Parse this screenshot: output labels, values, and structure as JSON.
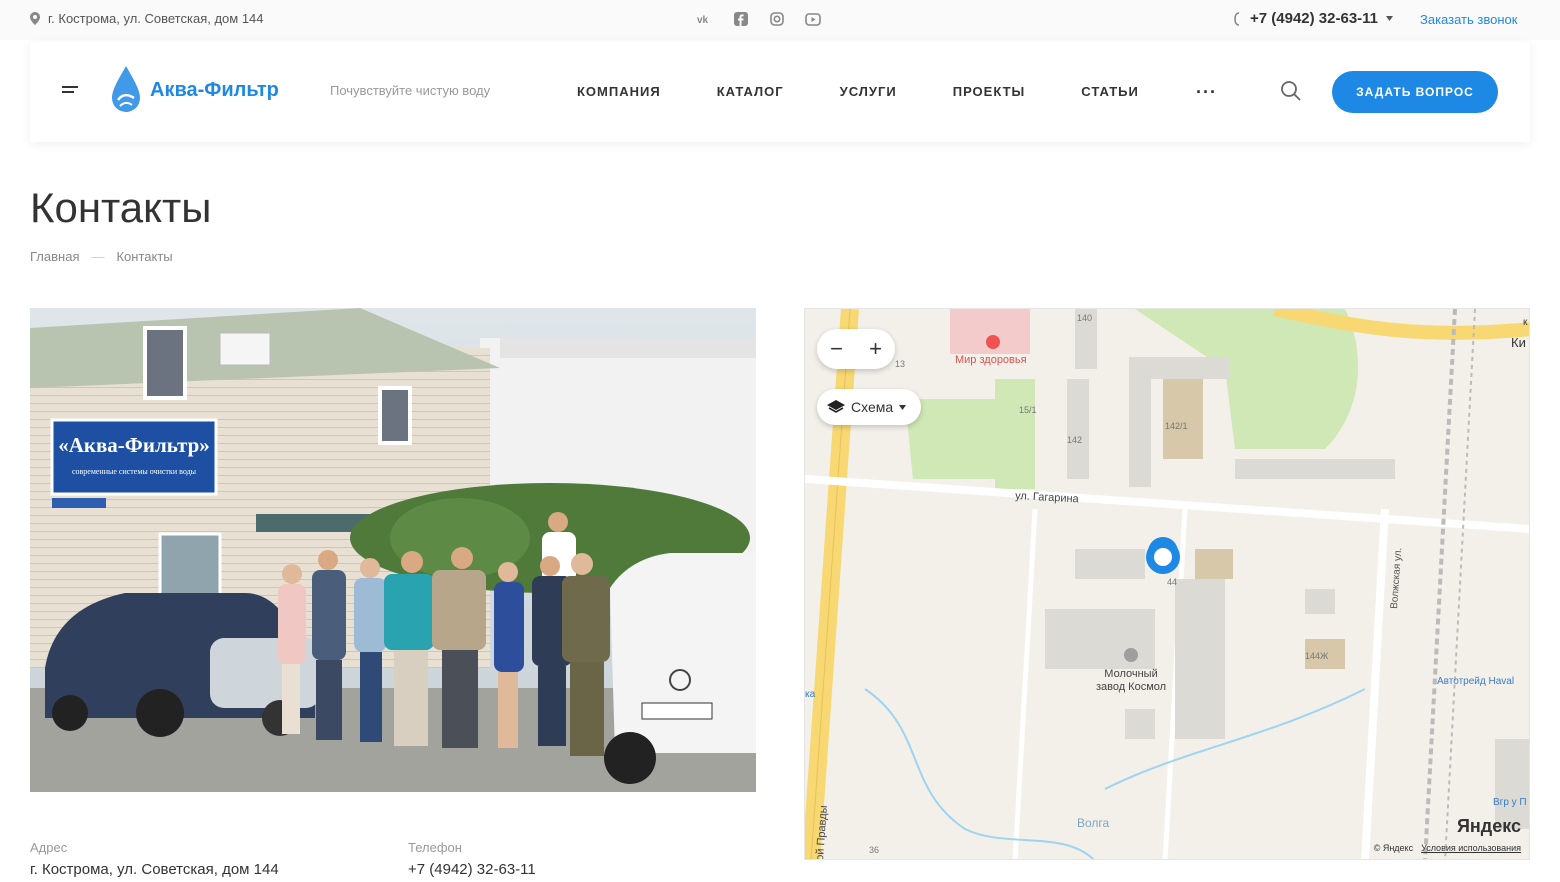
{
  "topbar": {
    "address": "г. Кострома, ул. Советская, дом 144",
    "social": [
      "vk-icon",
      "facebook-icon",
      "instagram-icon",
      "youtube-icon"
    ],
    "phone": "+7 (4942) 32-63-11",
    "callback": "Заказать звонок"
  },
  "header": {
    "logo_text": "Аква-Фильтр",
    "slogan": "Почувствуйте чистую воду",
    "nav": [
      "КОМПАНИЯ",
      "КАТАЛОГ",
      "УСЛУГИ",
      "ПРОЕКТЫ",
      "СТАТЬИ"
    ],
    "more": "···",
    "ask_button": "ЗАДАТЬ ВОПРОС",
    "accent": "#1e88e5"
  },
  "page": {
    "title": "Контакты",
    "breadcrumb": [
      "Главная",
      "—",
      "Контакты"
    ]
  },
  "photo": {
    "sign_line1": "«Аква-Фильтр»",
    "sign_line2": "современные системы очистки воды"
  },
  "map": {
    "zoom_out": "−",
    "zoom_in": "+",
    "layer_label": "Схема",
    "labels": {
      "mir_zdorovya": "Мир здоровья",
      "gagarina": "ул. Гагарина",
      "factory_line1": "Молочный",
      "factory_line2": "завод Космол",
      "volga": "Волга",
      "avtotreid": "Автотрейд Haval",
      "volzhskaya": "Волжская ул.",
      "pravdy": "ой Правды",
      "b140": "140",
      "b13": "13",
      "b151": "15/1",
      "b142": "142",
      "b1421": "142/1",
      "b144": "44",
      "b144zh": "144Ж",
      "b36": "36",
      "ki": "Ки",
      "vgr": "Вгр у П",
      "ka": "ка",
      "k": "к"
    },
    "brand": "Яндекс",
    "copyright": "© Яндекс",
    "terms": "Условия использования"
  },
  "contacts": {
    "address_label": "Адрес",
    "address_value": "г. Кострома, ул. Советская, дом 144",
    "phone_label": "Телефон",
    "phone_value": "+7 (4942) 32-63-11"
  }
}
